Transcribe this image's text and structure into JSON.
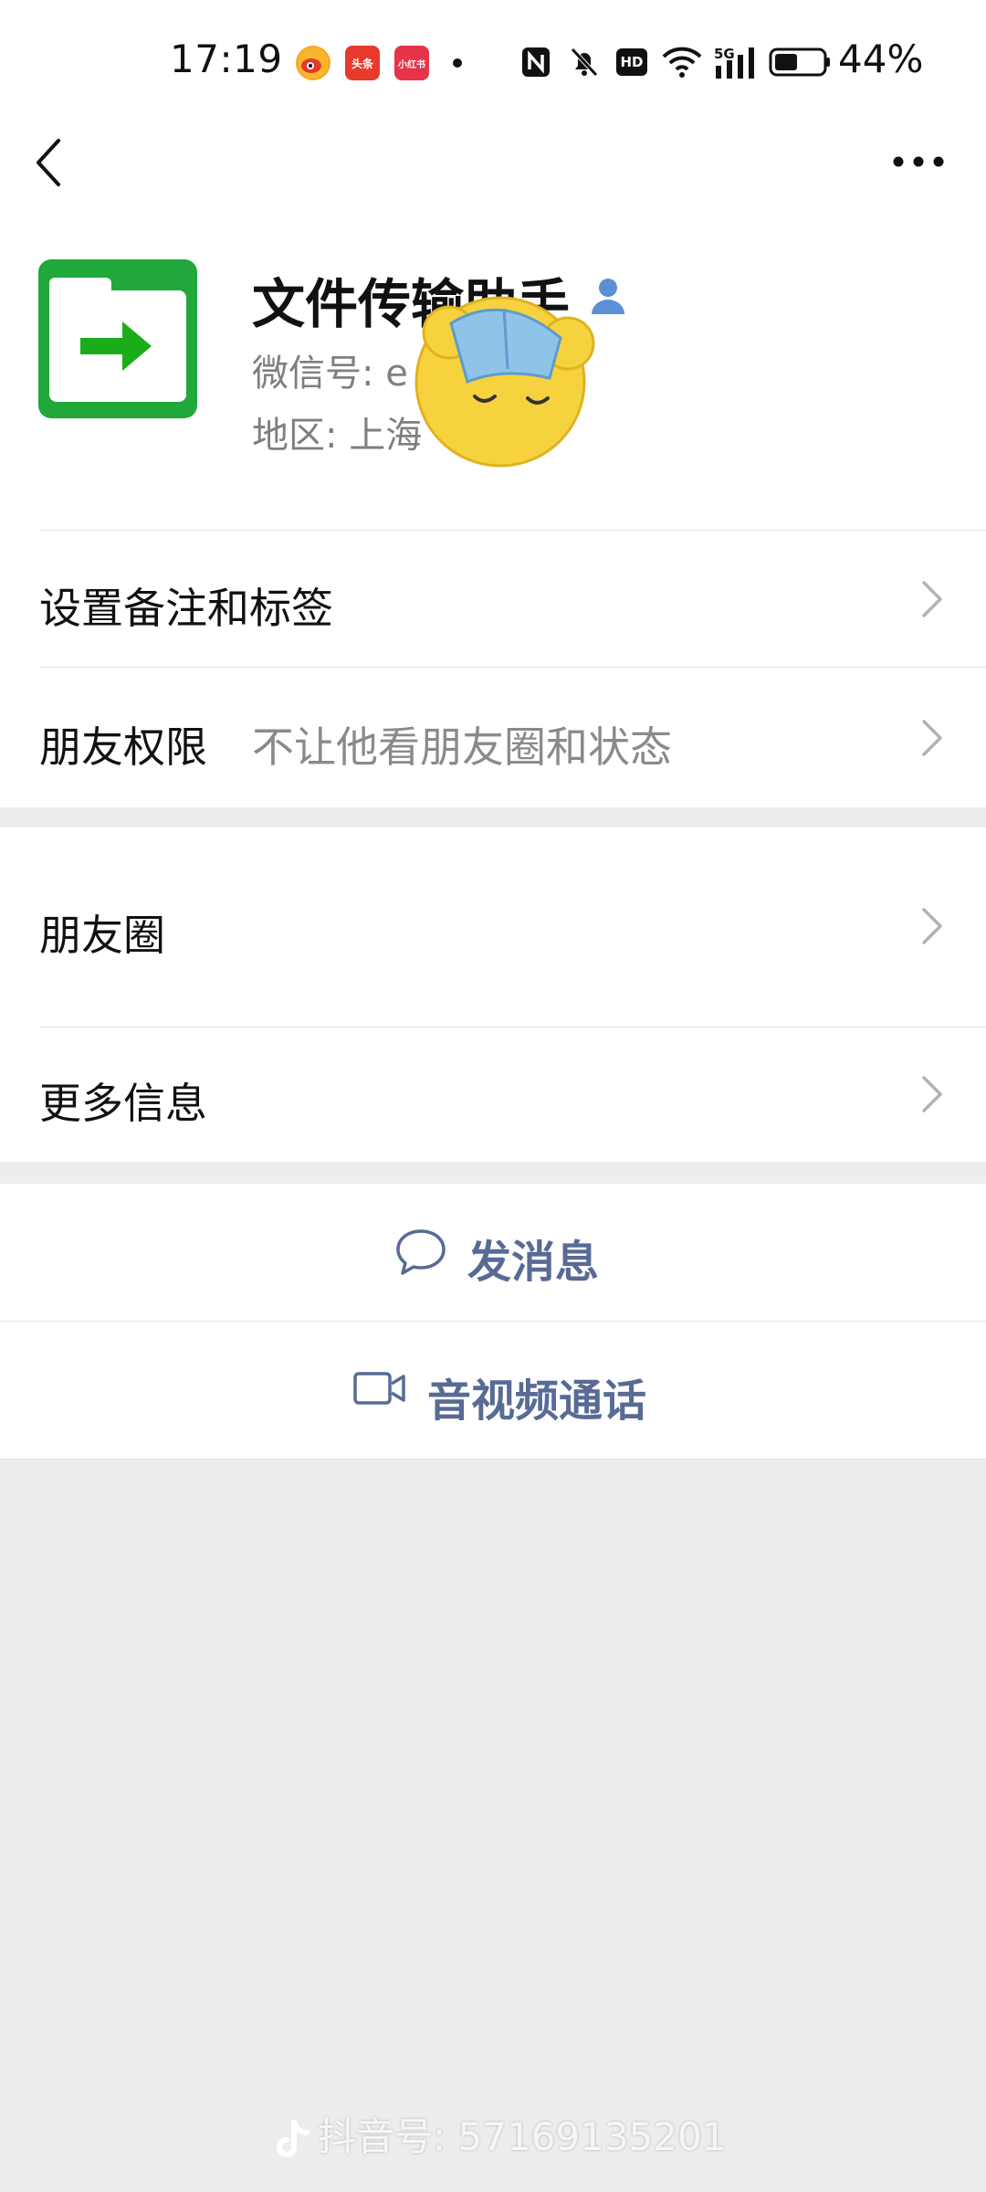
{
  "status_bar": {
    "time": "17:19",
    "app_icons": [
      {
        "name": "weibo-icon",
        "text": "",
        "color": "#f5a623"
      },
      {
        "name": "toutiao-icon",
        "text": "头条",
        "color": "#e8392d"
      },
      {
        "name": "xiaohongshu-icon",
        "text": "小红书",
        "color": "#e7334a"
      }
    ],
    "glyphs": [
      "nfc-icon",
      "mute-bell-icon",
      "hd-icon",
      "wifi-icon",
      "5g-signal-icon",
      "battery-icon"
    ],
    "hd_label": "HD",
    "net_label": "5G",
    "battery": "44%"
  },
  "nav": {
    "back_icon": "back-chevron-icon",
    "more_icon": "more-dots-icon"
  },
  "profile": {
    "name": "文件传输助手",
    "wechat_id_label": "微信号: e",
    "region_label": "地区: 上海",
    "avatar_color": "#20a83a",
    "arrow_color": "#1aad19"
  },
  "rows": {
    "remark": {
      "label": "设置备注和标签"
    },
    "friend_permission": {
      "label": "朋友权限",
      "value": "不让他看朋友圈和状态"
    },
    "moments": {
      "label": "朋友圈"
    },
    "more_info": {
      "label": "更多信息"
    }
  },
  "actions": {
    "send_message": "发消息",
    "video_call": "音视频通话",
    "accent_color": "#576b95"
  },
  "watermark": {
    "text": "抖音号: 57169135201"
  }
}
